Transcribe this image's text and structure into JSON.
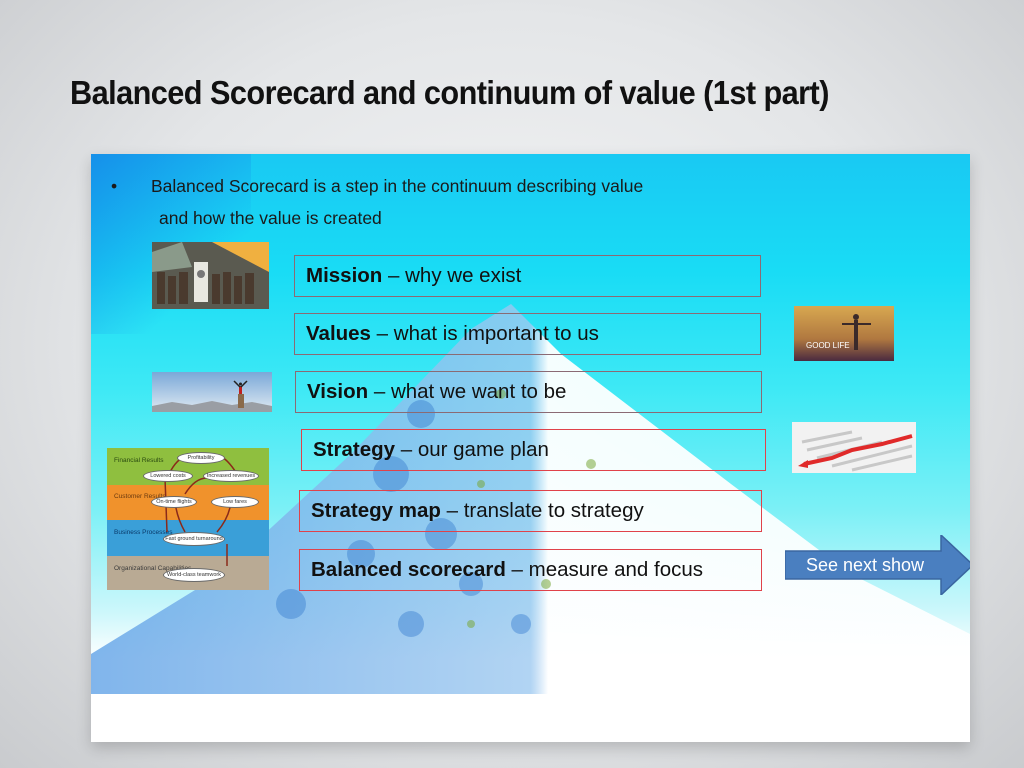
{
  "slide": {
    "title": "Balanced Scorecard and continuum of value (1st part)",
    "bullet": {
      "symbol": "•",
      "line1": "Balanced Scorecard is a step in the continuum describing value",
      "line2": "and how the value is created"
    },
    "levels": [
      {
        "term": "Mission",
        "separator": " – ",
        "description": "why we exist"
      },
      {
        "term": "Values",
        "separator": " – ",
        "description": "what is important to us"
      },
      {
        "term": "Vision",
        "separator": " – ",
        "description": "what we want to be"
      },
      {
        "term": "Strategy",
        "separator": " – ",
        "description": "our game plan"
      },
      {
        "term": "Strategy map",
        "separator": " – ",
        "description": "translate to strategy"
      },
      {
        "term": "Balanced scorecard",
        "separator": " – ",
        "description": "measure and focus"
      }
    ],
    "images": {
      "mission_photo": "crowd-with-priest-photo",
      "vision_photo": "person-on-summit-photo",
      "values_photo": {
        "name": "good-life-photo",
        "caption": "GOOD LIFE"
      },
      "strategy_photo": "red-arrow-maze-photo"
    },
    "strategy_map": {
      "perspectives": [
        {
          "label": "Financial Results",
          "color": "#8fbf3f"
        },
        {
          "label": "Customer Results",
          "color": "#f0922c"
        },
        {
          "label": "Business Processes",
          "color": "#3a9fd8"
        },
        {
          "label": "Organizational Capabilities",
          "color": "#b9aa94"
        }
      ],
      "objectives": {
        "profitability": "Profitability",
        "lowered_costs": "Lowered costs",
        "increased_revenues": "Increased revenues",
        "on_time_flights": "On-time flights",
        "low_fares": "Low fares",
        "fast_ground_turnaround": "Fast ground turnaround",
        "world_class_teamwork": "World-class teamwork"
      },
      "arrow_color": "#8a2a1a"
    },
    "next_button": {
      "label": "See next show",
      "color": "#4a7fc0"
    }
  }
}
